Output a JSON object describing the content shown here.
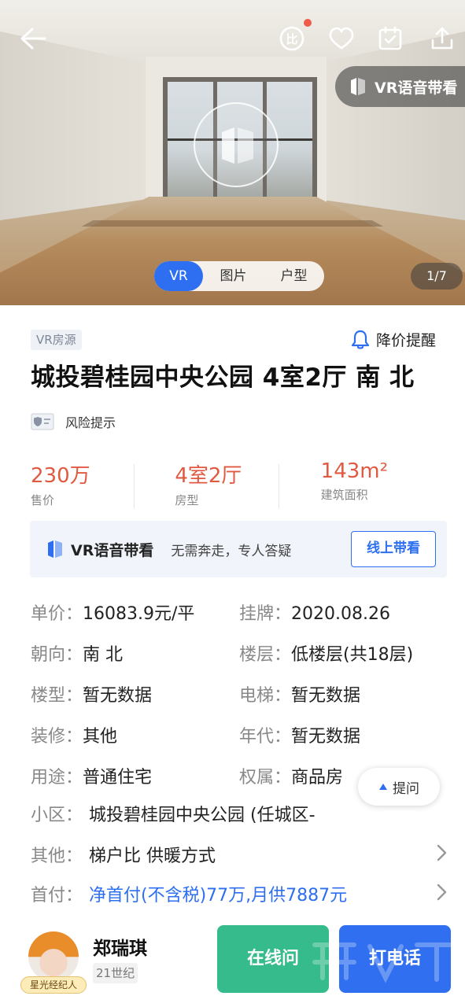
{
  "hero": {
    "vr_voice_label": "VR语音带看",
    "media_tabs": [
      {
        "label": "VR",
        "active": true
      },
      {
        "label": "图片",
        "active": false
      },
      {
        "label": "户型",
        "active": false
      }
    ],
    "pager": "1/7",
    "icons": [
      "back-arrow-icon",
      "compare-icon",
      "heart-icon",
      "calendar-check-icon",
      "share-icon"
    ],
    "compare_glyph": "比"
  },
  "listing": {
    "tag": "VR房源",
    "price_alert": "降价提醒",
    "title": "城投碧桂园中央公园 4室2厅 南 北",
    "risk": "风险提示",
    "stats": [
      {
        "value": "230万",
        "label": "售价"
      },
      {
        "value": "4室2厅",
        "label": "房型"
      },
      {
        "value": "143m²",
        "label": "建筑面积"
      }
    ]
  },
  "vr_banner": {
    "title": "VR语音带看",
    "desc": "无需奔走，专人答疑",
    "button": "线上带看"
  },
  "details": {
    "unit_price": {
      "key": "单价：",
      "value": "16083.9元/平"
    },
    "listed": {
      "key": "挂牌：",
      "value": "2020.08.26"
    },
    "orientation": {
      "key": "朝向：",
      "value": "南 北"
    },
    "floor": {
      "key": "楼层：",
      "value": "低楼层(共18层)"
    },
    "building_type": {
      "key": "楼型：",
      "value": "暂无数据"
    },
    "elevator": {
      "key": "电梯：",
      "value": "暂无数据"
    },
    "decoration": {
      "key": "装修：",
      "value": "其他"
    },
    "year": {
      "key": "年代：",
      "value": "暂无数据"
    },
    "usage": {
      "key": "用途：",
      "value": "普通住宅"
    },
    "ownership": {
      "key": "权属：",
      "value": "商品房"
    },
    "community": {
      "key": "小区：",
      "value": "城投碧桂园中央公园 (任城区-"
    },
    "other": {
      "key": "其他：",
      "value": "梯户比 供暖方式"
    },
    "down_payment": {
      "key": "首付：",
      "value": "净首付(不含税)77万,月供7887元"
    }
  },
  "ask_button": "提问",
  "agent": {
    "name": "郑瑞琪",
    "company": "21世纪",
    "badge": "星光经纪人",
    "chat_button": "在线问",
    "call_button": "打电话"
  },
  "colors": {
    "accent_blue": "#2d6ff0",
    "price_red": "#e05a41",
    "chat_green": "#36bb8c"
  }
}
